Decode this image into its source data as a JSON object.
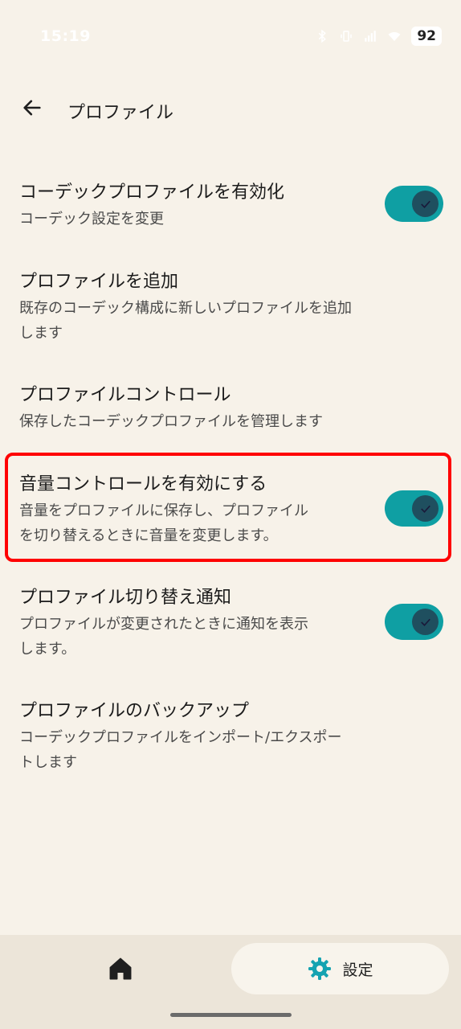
{
  "status_bar": {
    "time": "15:19",
    "battery": "92"
  },
  "app_bar": {
    "title": "プロファイル"
  },
  "settings": [
    {
      "title": "コーデックプロファイルを有効化",
      "summary_lines": [
        "コーデック設定を変更"
      ],
      "toggle": true
    },
    {
      "title": "プロファイルを追加",
      "summary_lines": [
        "既存のコーデック構成に新しいプロファイルを追加",
        "します"
      ],
      "toggle": false
    },
    {
      "title": "プロファイルコントロール",
      "summary_lines": [
        "保存したコーデックプロファイルを管理します"
      ],
      "toggle": false
    },
    {
      "title": "音量コントロールを有効にする",
      "summary_lines": [
        "音量をプロファイルに保存し、プロファイル",
        "を切り替えるときに音量を変更します。"
      ],
      "toggle": true,
      "highlighted": true
    },
    {
      "title": "プロファイル切り替え通知",
      "summary_lines": [
        "プロファイルが変更されたときに通知を表示",
        "します。"
      ],
      "toggle": true
    },
    {
      "title": "プロファイルのバックアップ",
      "summary_lines": [
        "コーデックプロファイルをインポート/エクスポー",
        "トします"
      ],
      "toggle": false
    }
  ],
  "bottom_nav": {
    "home_icon": "home-icon",
    "settings_icon": "gear-icon",
    "settings_label": "設定"
  },
  "colors": {
    "background": "#f7f2e9",
    "switch_track": "#0f9fa3",
    "switch_thumb": "#1f4f5f",
    "highlight": "#ff0000"
  }
}
